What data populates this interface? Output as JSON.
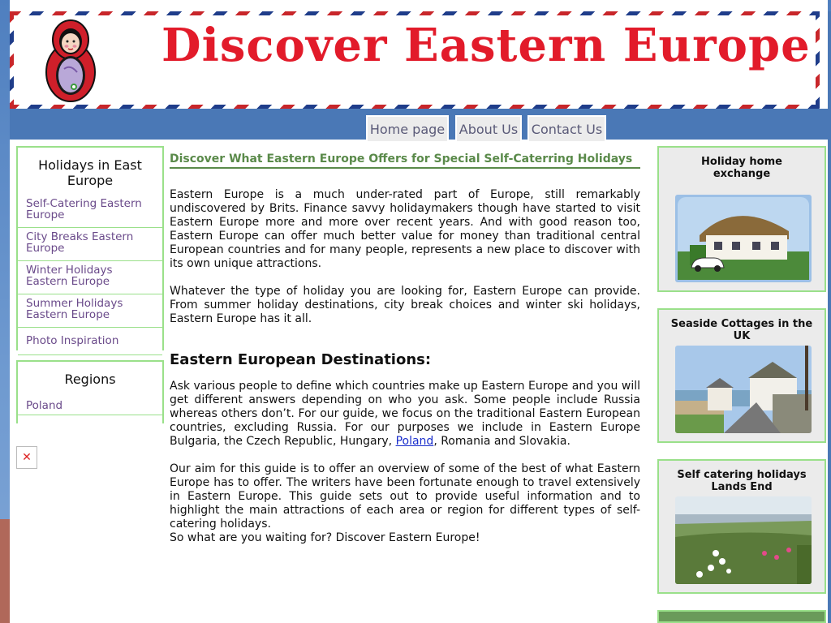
{
  "site_title": "Discover Eastern Europe",
  "nav": {
    "home": "Home page",
    "about": "About Us",
    "contact": "Contact Us"
  },
  "left_sidebar": {
    "holidays_heading": "Holidays in East Europe",
    "holidays_items": [
      {
        "label": "Self-Catering Eastern Europe"
      },
      {
        "label": "City Breaks Eastern Europe"
      },
      {
        "label": "Winter Holidays Eastern Europe"
      },
      {
        "label": "Summer Holidays Eastern Europe"
      },
      {
        "label": "Photo Inspiration"
      }
    ],
    "regions_heading": "Regions",
    "regions_items": [
      {
        "label": "Poland"
      }
    ],
    "broken_image_glyph": "✕"
  },
  "main": {
    "heading": "Discover What Eastern Europe Offers for Special Self-Caterring Holidays",
    "p1": "Eastern Europe is a much under-rated part of Europe, still remarkably undiscovered by Brits. Finance savvy holidaymakers though have started to visit Eastern Europe more and more over recent years. And with good reason too, Eastern Europe can offer much better value for money than traditional central European countries and for many people, represents a new place to discover with its own unique attractions.",
    "p2": "Whatever the type of holiday you are looking for, Eastern Europe can provide. From summer holiday destinations, city break choices and winter ski holidays, Eastern Europe has it all.",
    "subheading": "Eastern European Destinations:",
    "p3_before": "Ask various people to define which countries make up Eastern Europe and you will get different answers depending on who you ask. Some people include Russia whereas others don’t. For our guide, we focus on the traditional Eastern European countries, excluding Russia. For our purposes we include in Eastern Europe Bulgaria, the Czech Republic, Hungary, ",
    "p3_link": "Poland",
    "p3_after": ", Romania and Slovakia.",
    "p4": "Our aim for this guide is to offer an overview of some of the best of what Eastern Europe has to offer. The writers have been fortunate enough to travel extensively in Eastern Europe. This guide sets out to provide useful information and to highlight the main attractions of each area or region for different types of self-catering holidays.",
    "p5": "So what are you waiting for? Discover Eastern Europe!"
  },
  "right_sidebar": {
    "ad1_title": "Holiday home exchange",
    "ad2_title": "Seaside Cottages in the UK",
    "ad3_title": "Self catering holidays Lands End"
  },
  "colors": {
    "title_red": "#e21b2a",
    "heading_green": "#5a8a4a",
    "link_purple": "#6a4a8a",
    "border_green": "#9ae08a",
    "nav_blue": "#4a78b6"
  }
}
